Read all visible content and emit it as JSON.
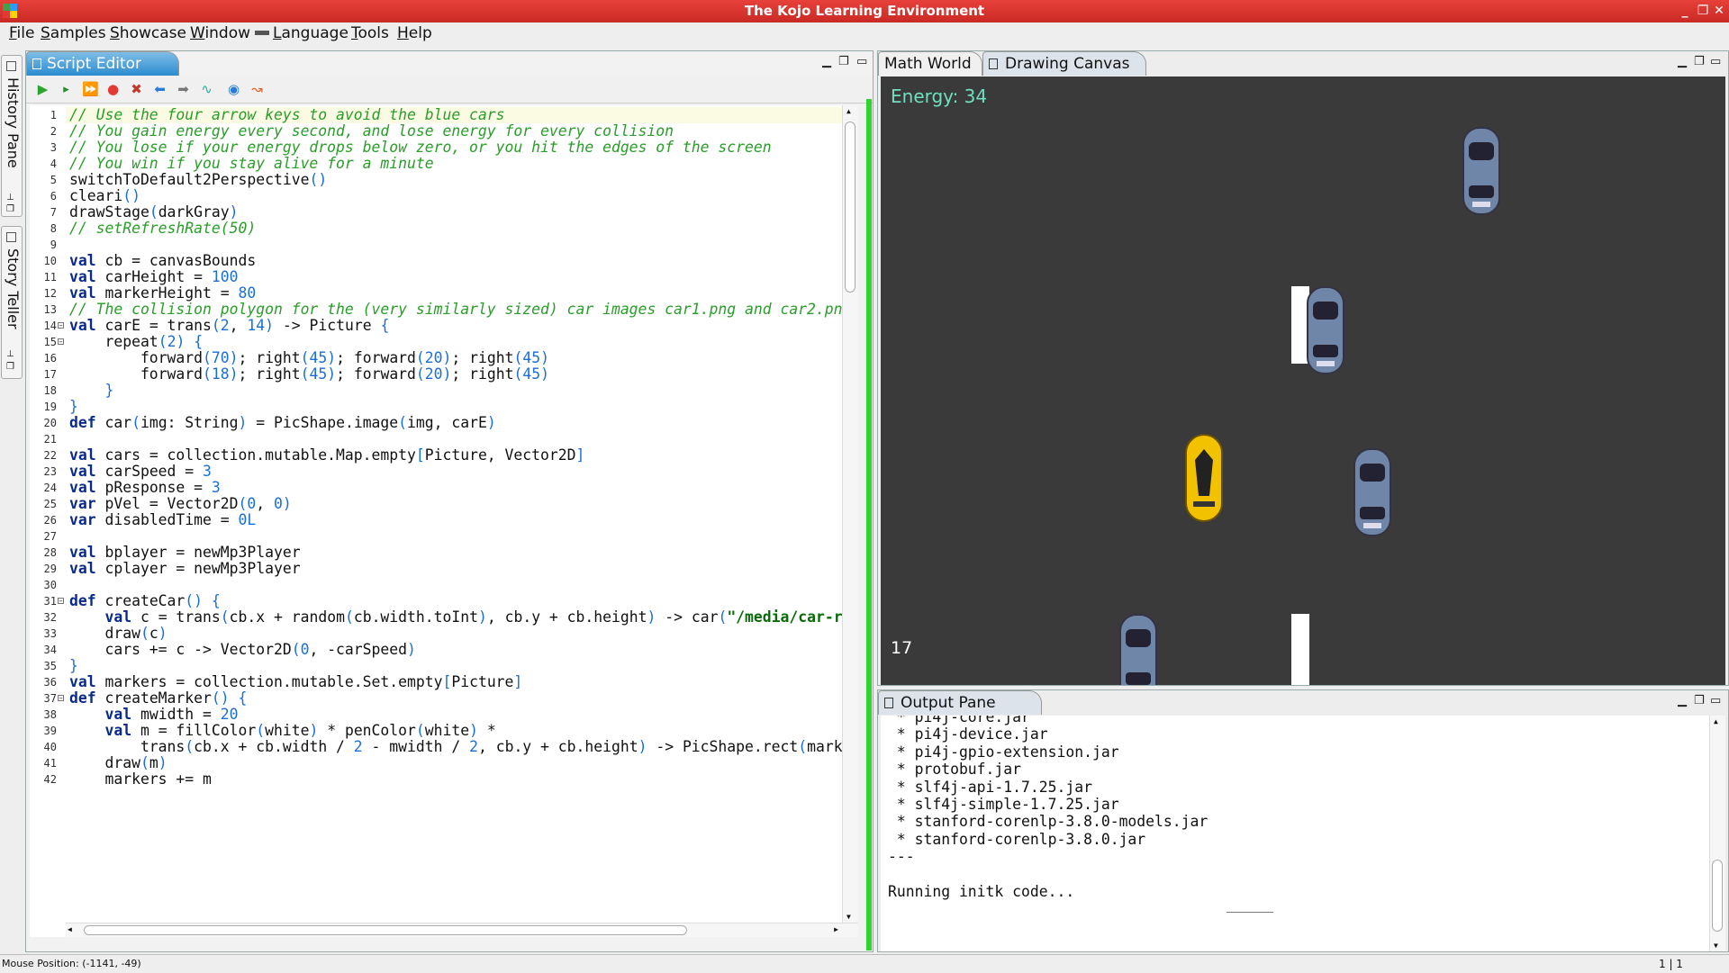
{
  "window": {
    "title": "The Kojo Learning Environment"
  },
  "menu": [
    "File",
    "Samples",
    "Showcase",
    "Window",
    "Language",
    "Tools",
    "Help"
  ],
  "side_tabs": {
    "history": "History Pane",
    "story": "Story Teller"
  },
  "editor": {
    "tab_label": "Script Editor",
    "toolbar_icons": [
      "run-icon",
      "run-worksheet-icon",
      "run-as-story-icon",
      "stop-icon",
      "clear-icon",
      "back-icon",
      "forward-icon",
      "format-icon",
      "browser-icon",
      "trace-icon"
    ],
    "lines": [
      {
        "n": "1",
        "t": "// Use the four arrow keys to avoid the blue cars"
      },
      {
        "n": "2",
        "t": "// You gain energy every second, and lose energy for every collision"
      },
      {
        "n": "3",
        "t": "// You lose if your energy drops below zero, or you hit the edges of the screen"
      },
      {
        "n": "4",
        "t": "// You win if you stay alive for a minute"
      },
      {
        "n": "5",
        "t": "switchToDefault2Perspective()"
      },
      {
        "n": "6",
        "t": "cleari()"
      },
      {
        "n": "7",
        "t": "drawStage(darkGray)"
      },
      {
        "n": "8",
        "t": "// setRefreshRate(50)"
      },
      {
        "n": "9",
        "t": ""
      },
      {
        "n": "10",
        "t": "val cb = canvasBounds"
      },
      {
        "n": "11",
        "t": "val carHeight = 100"
      },
      {
        "n": "12",
        "t": "val markerHeight = 80"
      },
      {
        "n": "13",
        "t": "// The collision polygon for the (very similarly sized) car images car1.png and car2.pn"
      },
      {
        "n": "14",
        "t": "val carE = trans(2, 14) -> Picture {"
      },
      {
        "n": "15",
        "t": "    repeat(2) {"
      },
      {
        "n": "16",
        "t": "        forward(70); right(45); forward(20); right(45)"
      },
      {
        "n": "17",
        "t": "        forward(18); right(45); forward(20); right(45)"
      },
      {
        "n": "18",
        "t": "    }"
      },
      {
        "n": "19",
        "t": "}"
      },
      {
        "n": "20",
        "t": "def car(img: String) = PicShape.image(img, carE)"
      },
      {
        "n": "21",
        "t": ""
      },
      {
        "n": "22",
        "t": "val cars = collection.mutable.Map.empty[Picture, Vector2D]"
      },
      {
        "n": "23",
        "t": "val carSpeed = 3"
      },
      {
        "n": "24",
        "t": "val pResponse = 3"
      },
      {
        "n": "25",
        "t": "var pVel = Vector2D(0, 0)"
      },
      {
        "n": "26",
        "t": "var disabledTime = 0L"
      },
      {
        "n": "27",
        "t": ""
      },
      {
        "n": "28",
        "t": "val bplayer = newMp3Player"
      },
      {
        "n": "29",
        "t": "val cplayer = newMp3Player"
      },
      {
        "n": "30",
        "t": ""
      },
      {
        "n": "31",
        "t": "def createCar() {"
      },
      {
        "n": "32",
        "t": "    val c = trans(cb.x + random(cb.width.toInt), cb.y + cb.height) -> car(\"/media/car-r"
      },
      {
        "n": "33",
        "t": "    draw(c)"
      },
      {
        "n": "34",
        "t": "    cars += c -> Vector2D(0, -carSpeed)"
      },
      {
        "n": "35",
        "t": "}"
      },
      {
        "n": "36",
        "t": "val markers = collection.mutable.Set.empty[Picture]"
      },
      {
        "n": "37",
        "t": "def createMarker() {"
      },
      {
        "n": "38",
        "t": "    val mwidth = 20"
      },
      {
        "n": "39",
        "t": "    val m = fillColor(white) * penColor(white) *"
      },
      {
        "n": "40",
        "t": "        trans(cb.x + cb.width / 2 - mwidth / 2, cb.y + cb.height) -> PicShape.rect(mark"
      },
      {
        "n": "41",
        "t": "    draw(m)"
      },
      {
        "n": "42",
        "t": "    markers += m"
      }
    ]
  },
  "canvas_panel": {
    "tabs": [
      "Math World",
      "Drawing Canvas"
    ],
    "energy": "Energy: 34",
    "timer": "17"
  },
  "output": {
    "tab_label": "Output Pane",
    "lines": [
      " * pi4j-core.jar",
      " * pi4j-device.jar",
      " * pi4j-gpio-extension.jar",
      " * protobuf.jar",
      " * slf4j-api-1.7.25.jar",
      " * slf4j-simple-1.7.25.jar",
      " * stanford-corenlp-3.8.0-models.jar",
      " * stanford-corenlp-3.8.0.jar",
      "---",
      "",
      "Running initk code..."
    ]
  },
  "status": {
    "mouse": "Mouse Position: (-1141, -49)",
    "position": "1 | 1"
  },
  "colors": {
    "title_bar": "#d93530",
    "canvas_bg": "#3a3a3a",
    "energy_text": "#6ee0c0",
    "player_car": "#f2c200",
    "enemy_car": "#6f86a8"
  }
}
